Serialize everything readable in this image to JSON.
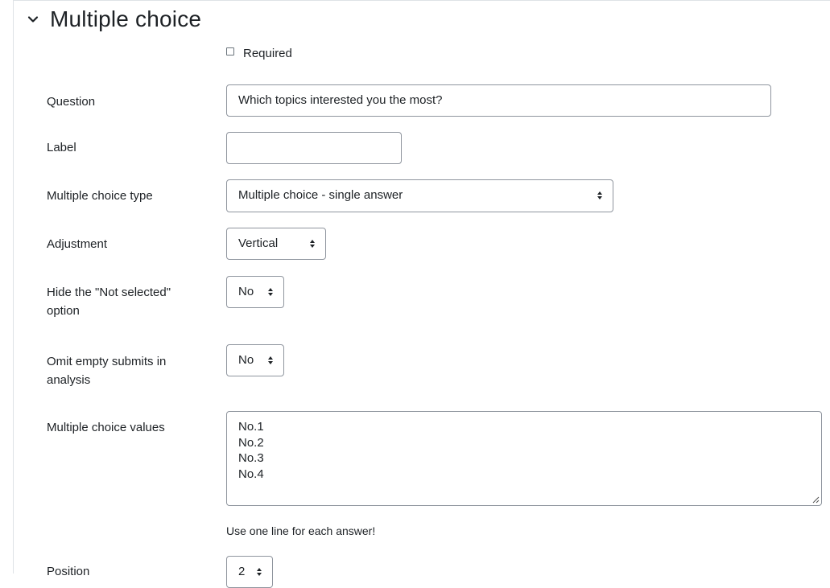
{
  "section": {
    "title": "Multiple choice",
    "required_label": "Required"
  },
  "form": {
    "question": {
      "label": "Question",
      "value": "Which topics interested you the most?"
    },
    "label_field": {
      "label": "Label",
      "value": ""
    },
    "mc_type": {
      "label": "Multiple choice type",
      "value": "Multiple choice - single answer"
    },
    "adjustment": {
      "label": "Adjustment",
      "value": "Vertical"
    },
    "hide_not_selected": {
      "label_line1": "Hide the \"Not selected\"",
      "label_line2": "option",
      "value": "No"
    },
    "omit_empty": {
      "label_line1": "Omit empty submits in",
      "label_line2": "analysis",
      "value": "No"
    },
    "mc_values": {
      "label": "Multiple choice values",
      "lines": [
        "No.1",
        "No.2",
        "No.3",
        "No.4"
      ],
      "help": "Use one line for each answer!"
    },
    "position": {
      "label": "Position",
      "value": "2"
    }
  }
}
